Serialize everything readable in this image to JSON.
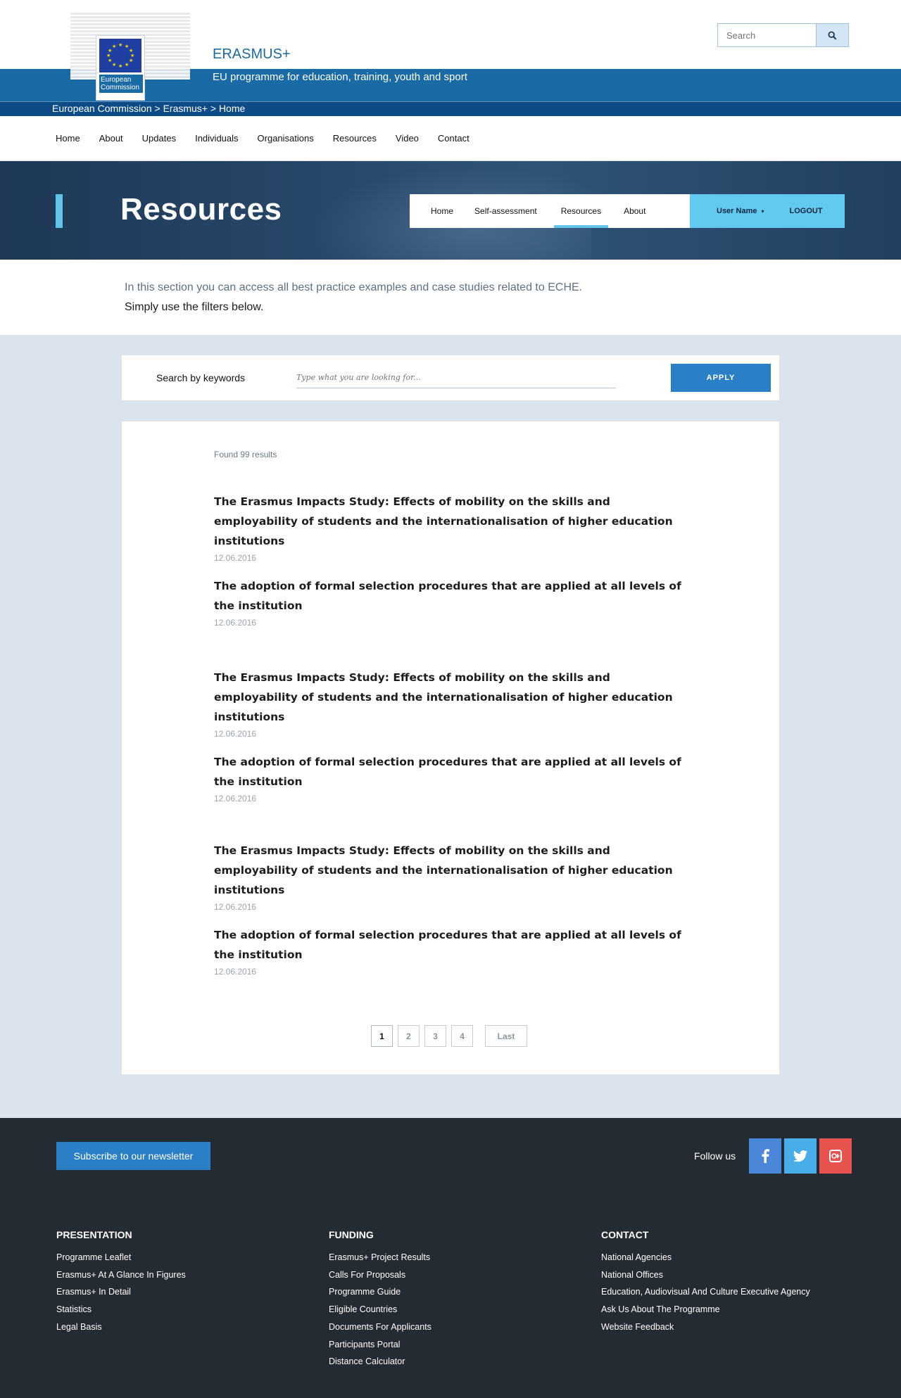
{
  "header": {
    "logo_text": "European Commission",
    "site_title": "ERASMUS+",
    "site_subtitle": "EU programme for education, training, youth and sport",
    "breadcrumb": "European Commission > Erasmus+ > Home",
    "search_placeholder": "Search",
    "search_icon": "magnifier-icon"
  },
  "main_nav": {
    "items": [
      "Home",
      "About",
      "Updates",
      "Individuals",
      "Organisations",
      "Resources",
      "Video",
      "Contact"
    ]
  },
  "hero": {
    "title": "Resources",
    "tabs": [
      "Home",
      "Self-assessment",
      "Resources",
      "About"
    ],
    "active_tab": "Resources",
    "user_name": "User Name",
    "user_caret": "▾",
    "logout": "LOGOUT"
  },
  "intro": {
    "line1": "In this section you can access all best practice examples and case studies related to ECHE.",
    "line2": "Simply use the filters below."
  },
  "filter": {
    "label": "Search by keywords",
    "placeholder": "Type what you are looking for...",
    "apply_label": "APPLY"
  },
  "results": {
    "found_text": "Found 99 results",
    "items": [
      {
        "title": "The Erasmus Impacts Study: Effects of mobility on the skills and employability of students and the internationalisation of higher education institutions",
        "date": "12.06.2016"
      },
      {
        "title": "The adoption of formal selection procedures that are applied at all levels of the institution",
        "date": "12.06.2016"
      },
      {
        "title": "The Erasmus Impacts Study: Effects of mobility on the skills and employability of students and the internationalisation of higher education institutions",
        "date": "12.06.2016"
      },
      {
        "title": "The adoption of formal selection procedures that are applied at all levels of the institution",
        "date": "12.06.2016"
      },
      {
        "title": "The Erasmus Impacts Study: Effects of mobility on the skills and employability of students and the internationalisation of higher education institutions",
        "date": "12.06.2016"
      },
      {
        "title": "The adoption of formal selection procedures that are applied at all levels of the institution",
        "date": "12.06.2016"
      }
    ],
    "pagination": {
      "pages": [
        "1",
        "2",
        "3",
        "4"
      ],
      "current": "1",
      "last_label": "Last"
    }
  },
  "footer": {
    "subscribe_label": "Subscribe to our newsletter",
    "follow_label": "Follow us",
    "social": [
      "facebook-icon",
      "twitter-icon",
      "google-plus-icon"
    ],
    "columns": [
      {
        "heading": "PRESENTATION",
        "links": [
          "Programme Leaflet",
          "Erasmus+ At A Glance In Figures",
          "Erasmus+ In Detail",
          "Statistics",
          "Legal Basis"
        ]
      },
      {
        "heading": "FUNDING",
        "links": [
          "Erasmus+ Project Results",
          "Calls For Proposals",
          "Programme Guide",
          "Eligible Countries",
          "Documents For Applicants",
          "Participants Portal",
          "Distance Calculator"
        ]
      },
      {
        "heading": "CONTACT",
        "links": [
          "National Agencies",
          "National Offices",
          "Education, Audiovisual And Culture Executive Agency",
          "Ask Us About The Programme",
          "Website Feedback"
        ]
      }
    ]
  },
  "colors": {
    "brand_blue": "#1a6aa6",
    "dark_blue": "#0d4b86",
    "accent_cyan": "#5fc6ea",
    "button_blue": "#2a7fc7",
    "content_bg": "#dbe4ec",
    "footer_bg": "#252b33"
  }
}
